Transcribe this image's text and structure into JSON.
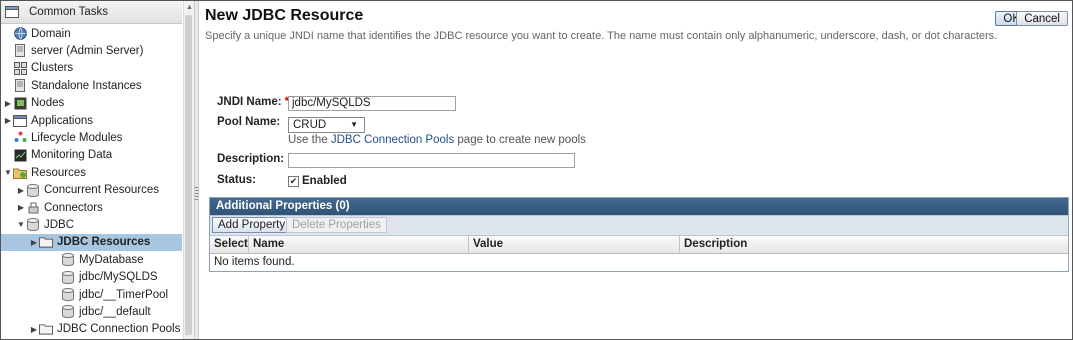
{
  "tree": {
    "header": "Common Tasks",
    "nodes": [
      {
        "label": "Domain",
        "icon": "domain-icon",
        "indent": 0,
        "expander": ""
      },
      {
        "label": "server (Admin Server)",
        "icon": "server-icon",
        "indent": 0,
        "expander": ""
      },
      {
        "label": "Clusters",
        "icon": "clusters-icon",
        "indent": 0,
        "expander": ""
      },
      {
        "label": "Standalone Instances",
        "icon": "server-icon",
        "indent": 0,
        "expander": ""
      },
      {
        "label": "Nodes",
        "icon": "nodes-icon",
        "indent": 0,
        "expander": "collapsed"
      },
      {
        "label": "Applications",
        "icon": "applications-icon",
        "indent": 0,
        "expander": "collapsed"
      },
      {
        "label": "Lifecycle Modules",
        "icon": "lifecycle-icon",
        "indent": 0,
        "expander": ""
      },
      {
        "label": "Monitoring Data",
        "icon": "monitoring-icon",
        "indent": 0,
        "expander": ""
      },
      {
        "label": "Resources",
        "icon": "resources-icon",
        "indent": 0,
        "expander": "expanded"
      },
      {
        "label": "Concurrent Resources",
        "icon": "database-icon",
        "indent": 1,
        "expander": "collapsed"
      },
      {
        "label": "Connectors",
        "icon": "connectors-icon",
        "indent": 1,
        "expander": "collapsed"
      },
      {
        "label": "JDBC",
        "icon": "database-icon",
        "indent": 1,
        "expander": "expanded"
      },
      {
        "label": "JDBC Resources",
        "icon": "folder-icon",
        "indent": 2,
        "expander": "collapsed",
        "selected": true
      },
      {
        "label": "MyDatabase",
        "icon": "database-icon",
        "indent": 3,
        "expander": ""
      },
      {
        "label": "jdbc/MySQLDS",
        "icon": "database-icon",
        "indent": 3,
        "expander": ""
      },
      {
        "label": "jdbc/__TimerPool",
        "icon": "database-icon",
        "indent": 3,
        "expander": ""
      },
      {
        "label": "jdbc/__default",
        "icon": "database-icon",
        "indent": 3,
        "expander": ""
      },
      {
        "label": "JDBC Connection Pools",
        "icon": "folder-icon",
        "indent": 2,
        "expander": "collapsed"
      }
    ]
  },
  "page": {
    "title": "New JDBC Resource",
    "help": "Specify a unique JNDI name that identifies the JDBC resource you want to create. The name must contain only alphanumeric, underscore, dash, or dot characters.",
    "ok_label": "OK",
    "cancel_label": "Cancel"
  },
  "form": {
    "jndi_label": "JNDI Name:",
    "required_mark": "*",
    "jndi_value": "jdbc/MySQLDS",
    "pool_label": "Pool Name:",
    "pool_value": "CRUD",
    "hint_prefix": "Use the ",
    "hint_link": "JDBC Connection Pools",
    "hint_suffix": " page to create new pools",
    "description_label": "Description:",
    "description_value": "",
    "status_label": "Status:",
    "enabled_label": "Enabled",
    "enabled_checked": true
  },
  "properties": {
    "title": "Additional Properties (0)",
    "add_label": "Add Property",
    "delete_label": "Delete Properties",
    "columns": [
      "Select",
      "Name",
      "Value",
      "Description"
    ],
    "empty_text": "No items found."
  },
  "colors": {
    "selected_row": "#a8c6e0",
    "table_header": "#2f5478",
    "link": "#1f4f8a",
    "required": "#cc0000"
  }
}
